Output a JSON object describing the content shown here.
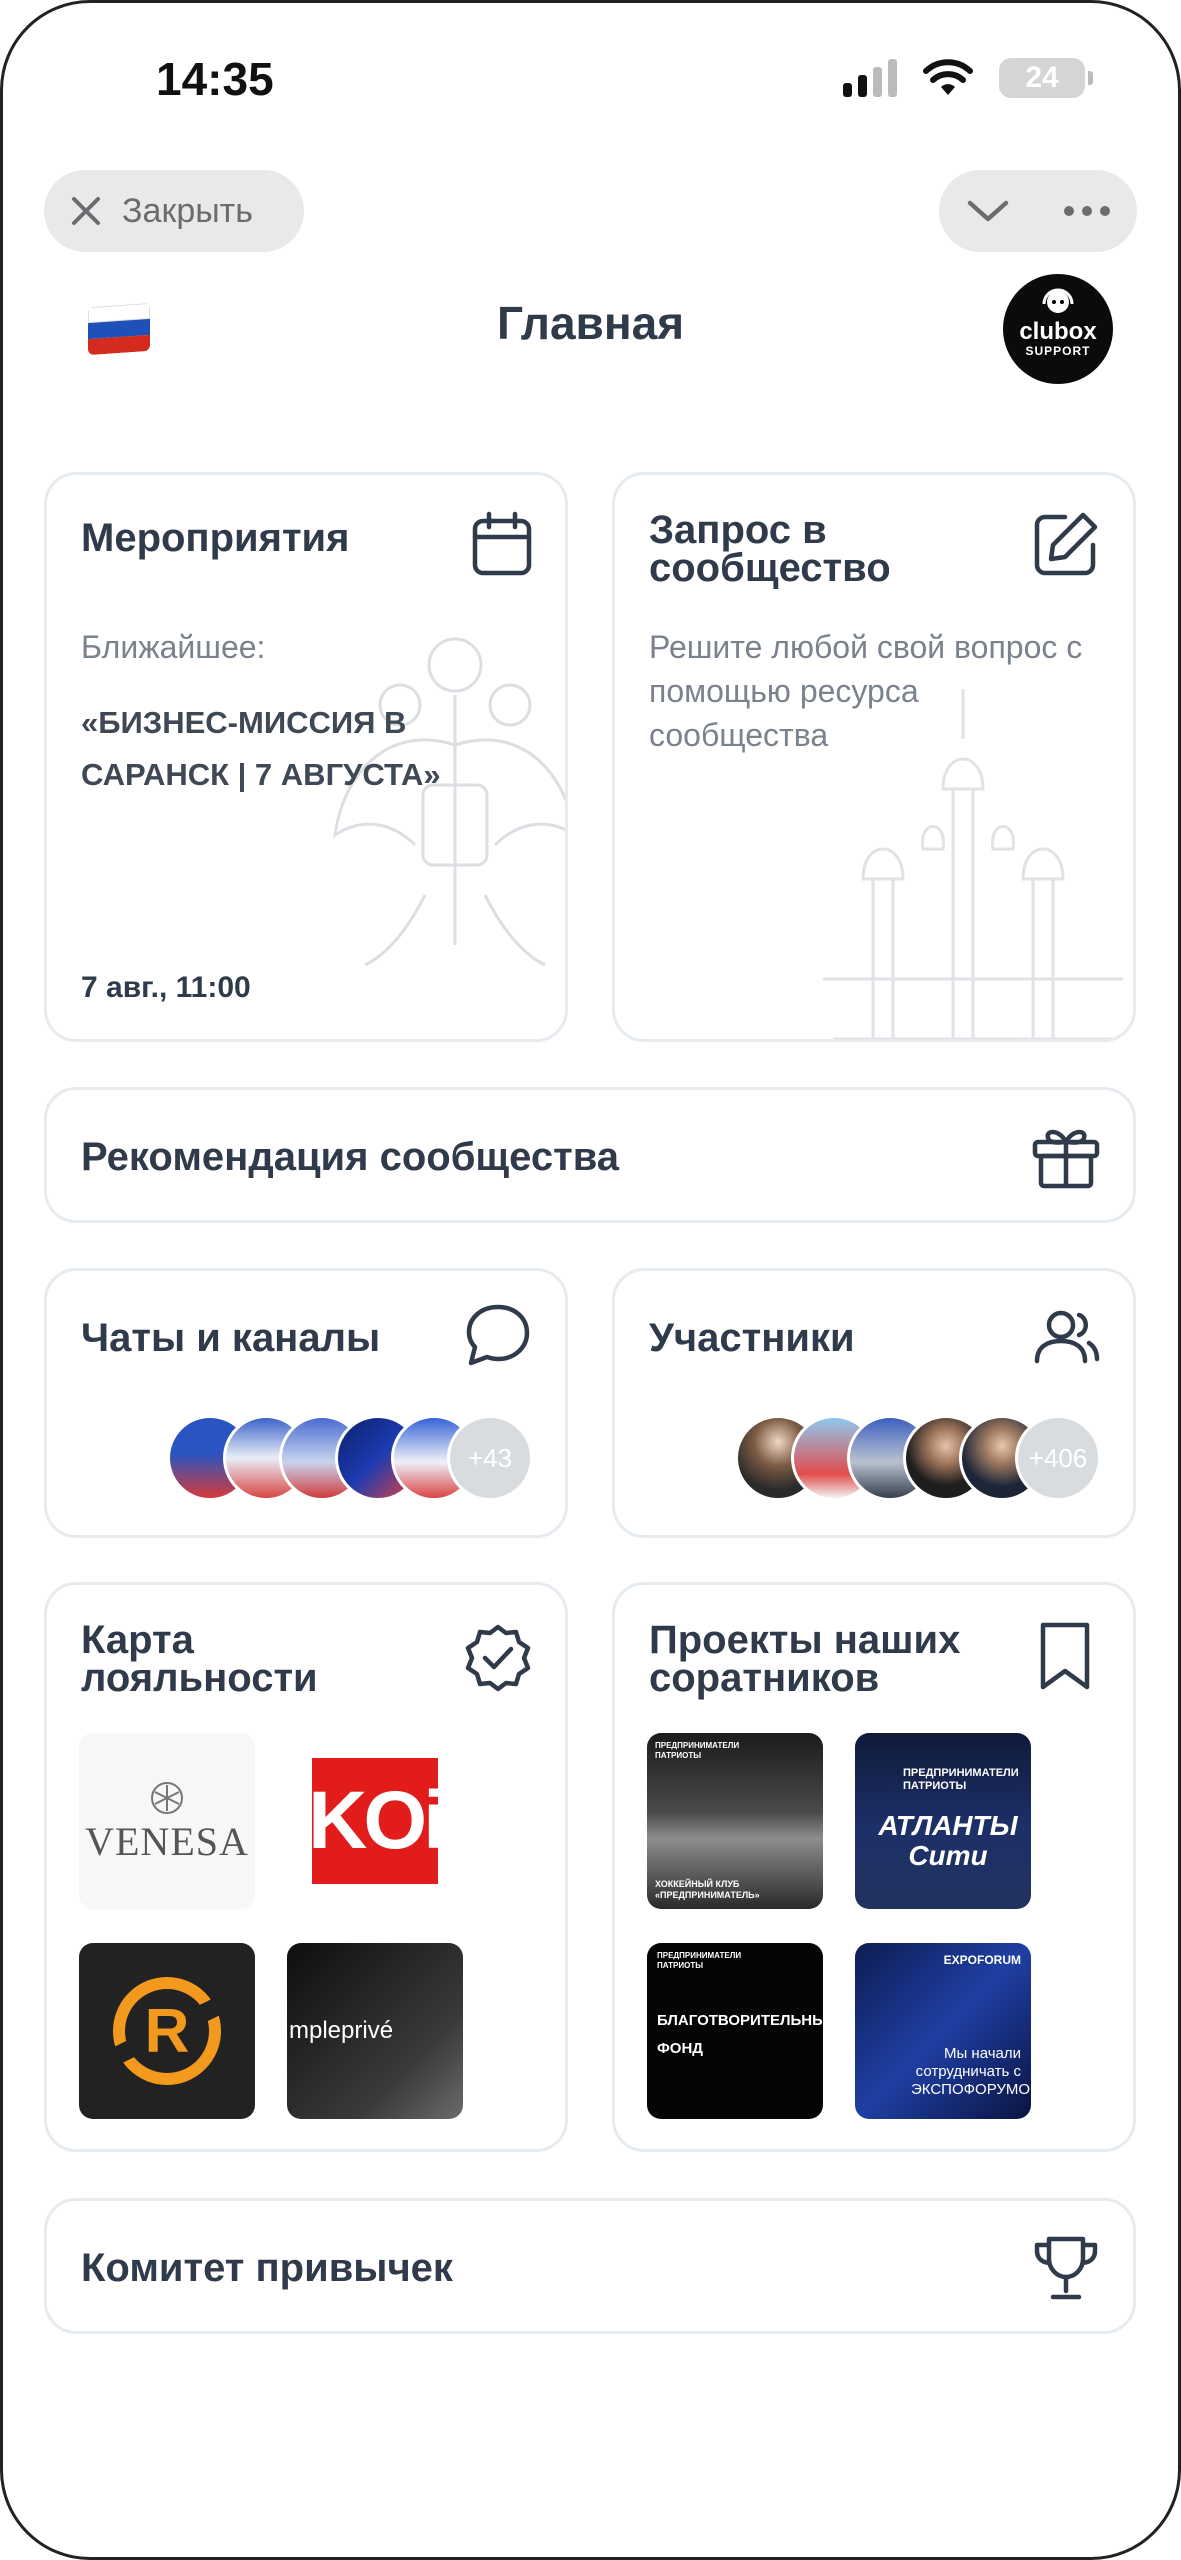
{
  "status_bar": {
    "time": "14:35",
    "battery": "24"
  },
  "top_controls": {
    "close_label": "Закрыть"
  },
  "header": {
    "title": "Главная"
  },
  "avatar": {
    "line1": "clubox",
    "line2": "SUPPORT"
  },
  "events_card": {
    "title": "Мероприятия",
    "nearest_label": "Ближайшее:",
    "event_name": "«БИЗНЕС-МИССИЯ В САРАНСК | 7 АВГУСТА»",
    "date": "7 авг., 11:00",
    "icon": "calendar-icon"
  },
  "request_card": {
    "title": "Запрос в сообщество",
    "description": "Решите любой свой вопрос с помощью ресурса сообщества",
    "icon": "edit-icon"
  },
  "recommendation_card": {
    "title": "Рекомендация сообщества",
    "icon": "gift-icon"
  },
  "chats_card": {
    "title": "Чаты и каналы",
    "more_count": "+43",
    "icon": "chat-icon"
  },
  "members_card": {
    "title": "Участники",
    "more_count": "+406",
    "icon": "users-icon"
  },
  "loyalty_card": {
    "title": "Карта лояльности",
    "icon": "badge-check-icon",
    "logos": [
      "VENESA",
      "KOi",
      "R",
      "mpleprivé"
    ]
  },
  "projects_card": {
    "title": "Проекты наших соратников",
    "icon": "bookmark-icon",
    "tiles": [
      {
        "caption": "ХОККЕЙНЫЙ КЛУБ «ПРЕДПРИНИМАТЕЛЬ»",
        "brand": "ПРЕДПРИНИМАТЕЛИ ПАТРИОТЫ"
      },
      {
        "caption": "АТЛАНТЫ Сити",
        "brand": "ПРЕДПРИНИМАТЕЛИ ПАТРИОТЫ"
      },
      {
        "caption": "БЛАГОТВОРИТЕЛЬНЫЙ ФОНД",
        "brand": "ПРЕДПРИНИМАТЕЛИ ПАТРИОТЫ"
      },
      {
        "caption": "Мы начали сотрудничать с ЭКСПОФОРУМОМ",
        "brand": "EXPOFORUM"
      }
    ]
  },
  "habits_card": {
    "title": "Комитет привычек",
    "icon": "trophy-icon"
  }
}
